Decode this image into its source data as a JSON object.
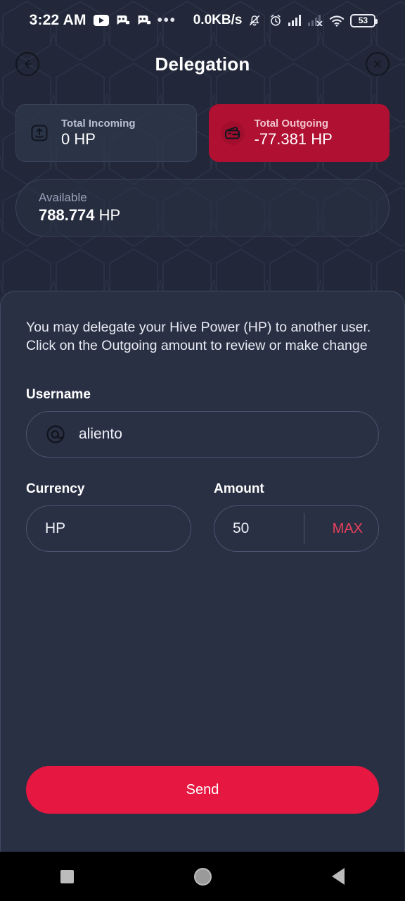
{
  "status_bar": {
    "time": "3:22 AM",
    "app_icons": [
      "youtube-icon",
      "chat-icon",
      "chat-icon"
    ],
    "overflow_dots": "•••",
    "network_speed": "0.0KB/s",
    "tray_icons": [
      "bell-muted-icon",
      "alarm-icon",
      "signal-full-icon",
      "signal-no-sim-icon",
      "wifi-icon"
    ],
    "battery_percent": "53"
  },
  "header": {
    "back_label": "back-arrow",
    "title": "Delegation",
    "close_label": "close"
  },
  "summary": {
    "incoming": {
      "icon": "upload-box-icon",
      "label": "Total Incoming",
      "value": "0 HP"
    },
    "outgoing": {
      "icon": "wallet-icon",
      "label": "Total Outgoing",
      "value": "-77.381 HP",
      "background": "#b01032"
    },
    "available": {
      "label": "Available",
      "amount": "788.774",
      "unit": "HP"
    }
  },
  "panel": {
    "description": "You may delegate your Hive Power (HP) to another user. Click on the Outgoing amount to review or make change",
    "username": {
      "label": "Username",
      "icon": "at-icon",
      "value": "aliento",
      "placeholder": "Username"
    },
    "currency": {
      "label": "Currency",
      "value": "HP",
      "options": [
        "HP"
      ]
    },
    "amount": {
      "label": "Amount",
      "value": "50",
      "placeholder": "Amount",
      "max_label": "MAX",
      "max_color": "#e8405a"
    },
    "send_label": "Send",
    "send_color": "#e61741"
  },
  "nav_bar": {
    "recents": "recents-square",
    "home": "home-circle",
    "back": "back-triangle"
  }
}
